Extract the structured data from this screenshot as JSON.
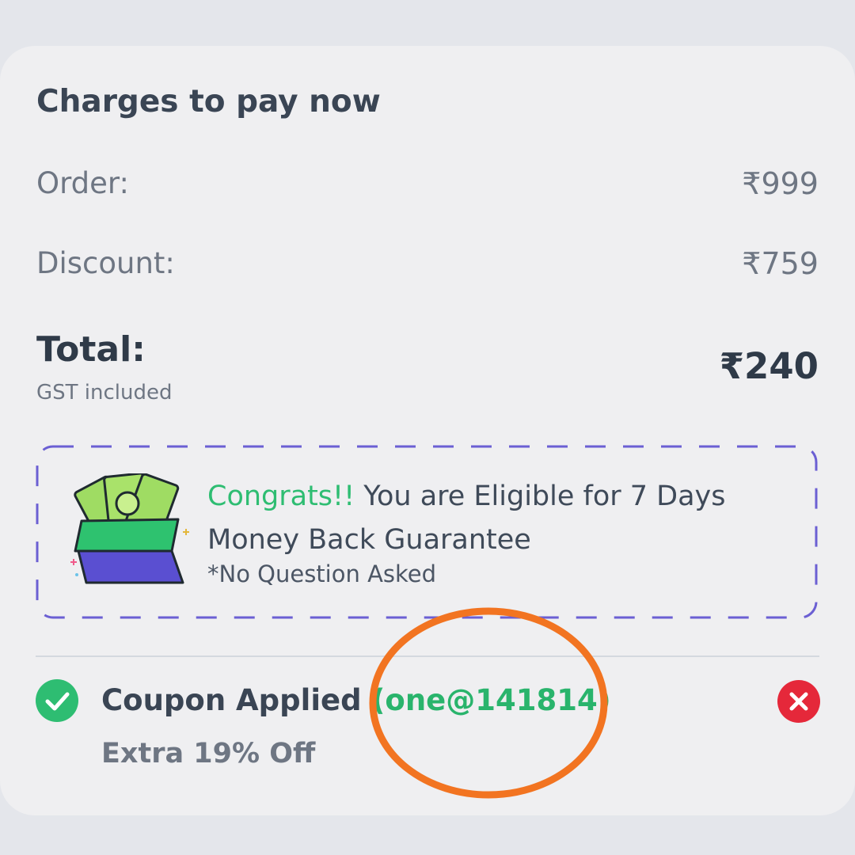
{
  "charges": {
    "heading": "Charges to pay now",
    "order_label": "Order:",
    "order_value": "₹999",
    "discount_label": "Discount:",
    "discount_value": "₹759",
    "total_label": "Total:",
    "total_note": "GST included",
    "total_value": "₹240"
  },
  "guarantee": {
    "congrats": "Congrats!!",
    "message": " You are Eligible for 7 Days Money Back Guarantee",
    "note": "*No Question Asked",
    "icon": "money-stack-icon"
  },
  "coupon": {
    "label": "Coupon Applied ",
    "code": "(one@141814)",
    "subtext": "Extra 19% Off",
    "status_icon": "check-circle-icon",
    "remove_icon": "close-circle-icon"
  },
  "colors": {
    "accent_green": "#2ebd72",
    "remove_red": "#e5283a",
    "dash_border": "#6b5fd3",
    "annotation_orange": "#f27421"
  }
}
